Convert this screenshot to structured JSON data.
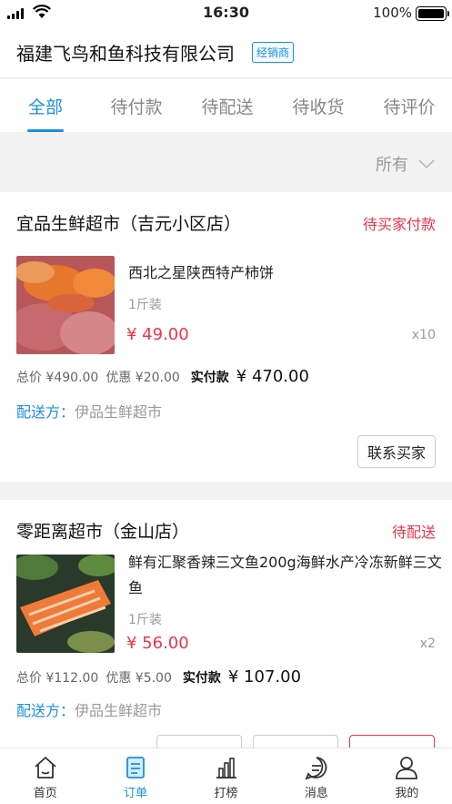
{
  "status_bar": {
    "time": "16:30",
    "battery": "100%",
    "battery_level": 1.0
  },
  "header": {
    "company": "福建飞鸟和鱼科技有限公司",
    "badge": "经销商"
  },
  "tabs": [
    {
      "label": "全部",
      "active": true
    },
    {
      "label": "待付款",
      "active": false
    },
    {
      "label": "待配送",
      "active": false
    },
    {
      "label": "待收货",
      "active": false
    },
    {
      "label": "待评价",
      "active": false
    }
  ],
  "filter": {
    "label": "所有"
  },
  "orders": [
    {
      "store": "宜品生鲜超市（吉元小区店）",
      "status": "待买家付款",
      "product": {
        "name": "西北之星陕西特产柿饼",
        "spec": "1斤装",
        "price": "¥ 49.00",
        "qty": "x10",
        "image": "persimmon-image"
      },
      "total_label": "总价 ¥490.00",
      "discount_label": "优惠 ¥20.00",
      "paid_label": "实付款",
      "paid_value": "¥ 470.00",
      "delivery_label": "配送方：",
      "delivery_value": "伊品生鲜超市",
      "buttons": [
        "联系买家"
      ]
    },
    {
      "store": "零距离超市（金山店）",
      "status": "待配送",
      "product": {
        "name": "鲜有汇聚香辣三文鱼200g海鲜水产冷冻新鲜三文鱼",
        "spec": "1斤装",
        "price": "¥ 56.00",
        "qty": "x2",
        "image": "salmon-image"
      },
      "total_label": "总价 ¥112.00",
      "discount_label": "优惠 ¥5.00",
      "paid_label": "实付款",
      "paid_value": "¥ 107.00",
      "delivery_label": "配送方：",
      "delivery_value": "伊品生鲜超市"
    }
  ],
  "tabbar": [
    {
      "label": "首页",
      "icon": "home-icon",
      "active": false
    },
    {
      "label": "订单",
      "icon": "order-icon",
      "active": true
    },
    {
      "label": "打榜",
      "icon": "chart-icon",
      "active": false
    },
    {
      "label": "消息",
      "icon": "message-icon",
      "active": false
    },
    {
      "label": "我的",
      "icon": "profile-icon",
      "active": false
    }
  ],
  "colors": {
    "accent": "#1a8fe3",
    "alert": "#f0334a"
  }
}
